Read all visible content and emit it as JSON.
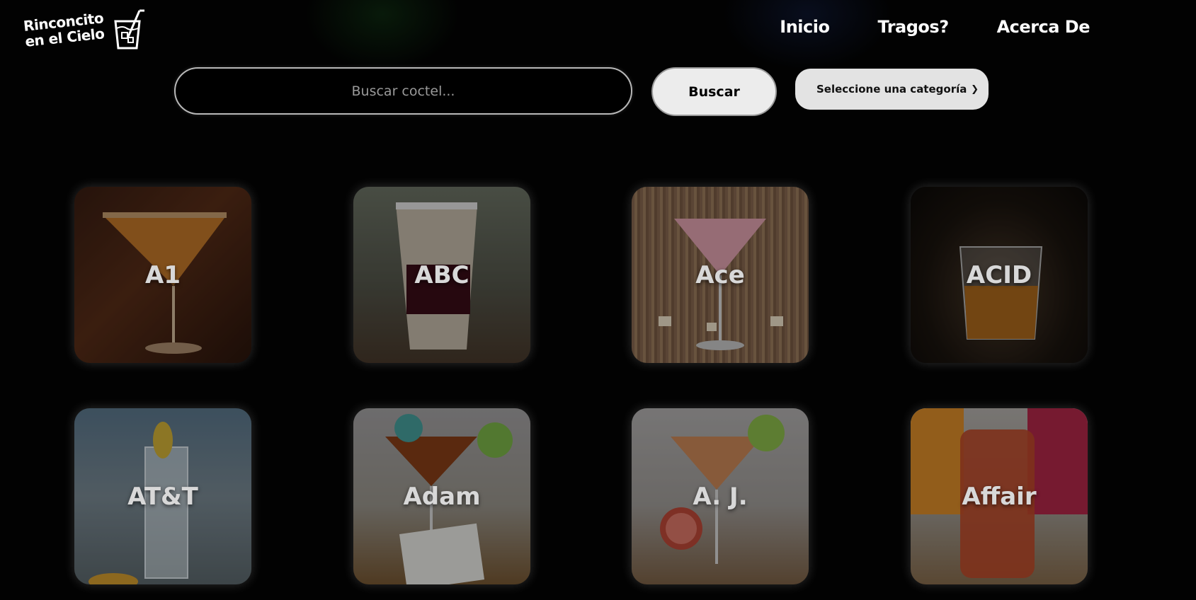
{
  "brand": {
    "line1": "Rinconcito",
    "line2": "en el Cielo"
  },
  "nav": {
    "items": [
      "Inicio",
      "Tragos?",
      "Acerca De"
    ]
  },
  "search": {
    "placeholder": "Buscar coctel...",
    "button_label": "Buscar"
  },
  "category": {
    "selected": "Seleccione una categoría"
  },
  "cards": [
    {
      "name": "A1"
    },
    {
      "name": "ABC"
    },
    {
      "name": "Ace"
    },
    {
      "name": "ACID"
    },
    {
      "name": "AT&T"
    },
    {
      "name": "Adam"
    },
    {
      "name": "A. J."
    },
    {
      "name": "Affair"
    }
  ],
  "colors": {
    "background": "#020202",
    "button_bg": "#ececec",
    "select_bg": "#e3e3e3",
    "text": "#ffffff"
  }
}
